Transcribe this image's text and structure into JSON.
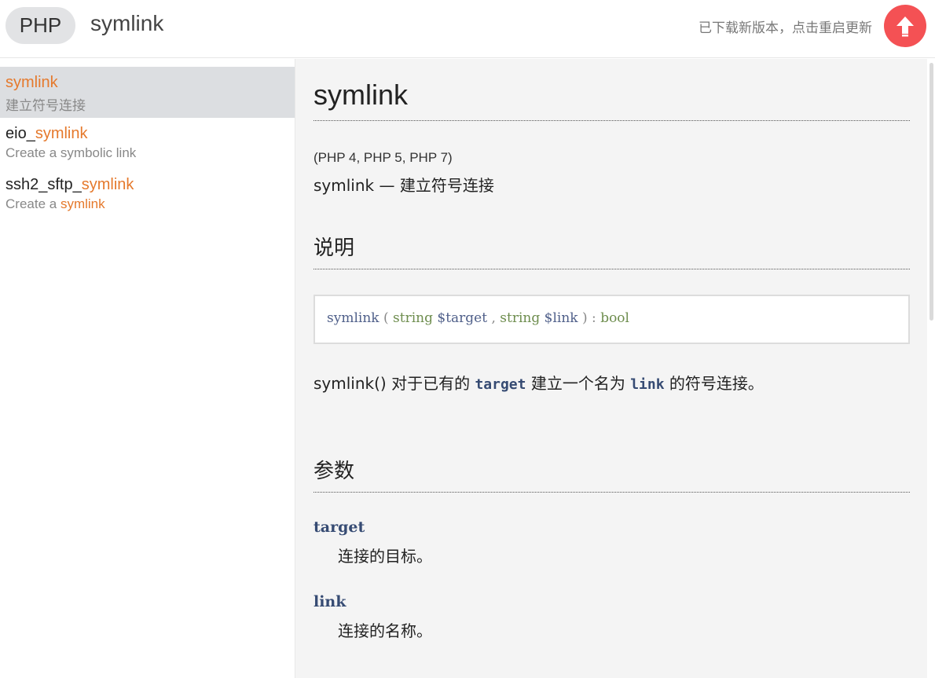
{
  "header": {
    "language": "PHP",
    "keyword": "symlink",
    "update_message": "已下载新版本，点击重启更新",
    "accent_color": "#f45154"
  },
  "sidebar": {
    "highlight_color": "#e5792c",
    "results": [
      {
        "name_prefix": "",
        "name_match": "symlink",
        "desc_prefix": "",
        "desc_match": "",
        "desc": "建立符号连接",
        "active": true
      },
      {
        "name_prefix": "eio_",
        "name_match": "symlink",
        "desc_prefix": "Create a symbolic link",
        "desc_match": "",
        "desc": "",
        "active": false
      },
      {
        "name_prefix": "ssh2_sftp_",
        "name_match": "symlink",
        "desc_prefix": "Create a ",
        "desc_match": "symlink",
        "desc": "",
        "active": false
      }
    ]
  },
  "doc": {
    "title": "symlink",
    "versions": "(PHP 4, PHP 5, PHP 7)",
    "refpurpose": "symlink — 建立符号连接",
    "section_description": "说明",
    "signature": {
      "function": "symlink",
      "open": " ( ",
      "param1_type": "string",
      "param1_var": "$target",
      "sep": " , ",
      "param2_type": "string",
      "param2_var": "$link",
      "close": " ) : ",
      "return_type": "bool"
    },
    "description": {
      "part1": "symlink() 对于已有的 ",
      "code1": "target",
      "part2": " 建立一个名为 ",
      "code2": "link",
      "part3": " 的符号连接。"
    },
    "section_parameters": "参数",
    "parameters": [
      {
        "name": "target",
        "desc": "连接的目标。"
      },
      {
        "name": "link",
        "desc": "连接的名称。"
      }
    ]
  }
}
